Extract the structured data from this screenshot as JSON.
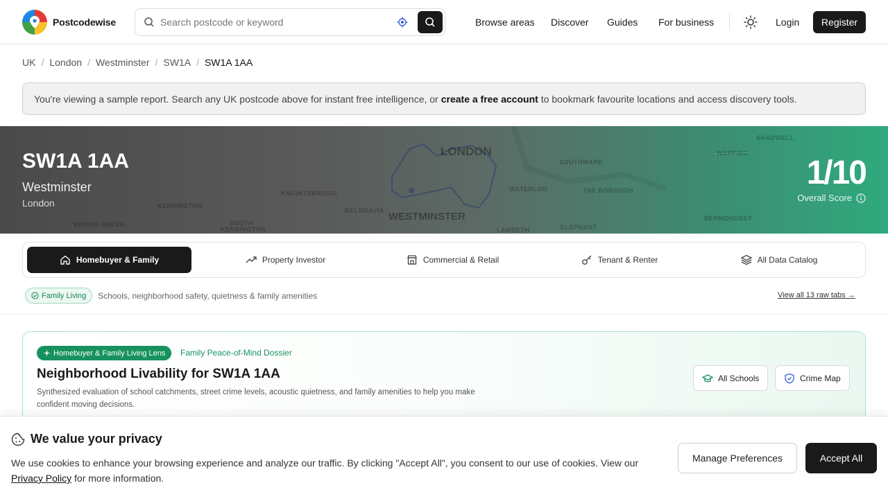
{
  "brand": {
    "name": "Postcodewise"
  },
  "search": {
    "placeholder": "Search postcode or keyword"
  },
  "nav": {
    "browse": "Browse areas",
    "discover": "Discover",
    "guides": "Guides",
    "business": "For business",
    "login": "Login",
    "register": "Register"
  },
  "breadcrumb": [
    "UK",
    "London",
    "Westminster",
    "SW1A",
    "SW1A 1AA"
  ],
  "notice": {
    "before": "You're viewing a sample report. Search any UK postcode above for instant free intelligence, or",
    "link": "create a free account",
    "after": "to bookmark favourite locations and access discovery tools."
  },
  "hero": {
    "postcode": "SW1A 1AA",
    "district": "Westminster",
    "city": "London",
    "score": "1/10",
    "score_label": "Overall Score",
    "map_labels": [
      "LONDON",
      "WESTMINSTER",
      "KENSINGTON",
      "KNIGHTSBRIDGE",
      "BELGRAVIA",
      "SOUTHWARK",
      "WATERLOO",
      "THE BOROUGH",
      "LAMBETH",
      "ELEPHANT",
      "BERMONDSEY",
      "SOUTH KENSINGTON",
      "BROOK GREEN",
      "SHADWELL",
      "WAPPING"
    ]
  },
  "tabs": [
    {
      "label": "Homebuyer & Family",
      "icon": "home-icon"
    },
    {
      "label": "Property Investor",
      "icon": "trending-up-icon"
    },
    {
      "label": "Commercial & Retail",
      "icon": "store-icon"
    },
    {
      "label": "Tenant & Renter",
      "icon": "key-icon"
    },
    {
      "label": "All Data Catalog",
      "icon": "layers-icon"
    }
  ],
  "lens": {
    "chip": "Family Living",
    "desc": "Schools, neighborhood safety, quietness & family amenities",
    "view_all": "View all 13 raw tabs →"
  },
  "card": {
    "badge": "Homebuyer & Family Living Lens",
    "dossier": "Family Peace-of-Mind Dossier",
    "title": "Neighborhood Livability for SW1A 1AA",
    "desc": "Synthesized evaluation of school catchments, street crime levels, acoustic quietness, and family amenities to help you make confident moving decisions.",
    "btn_schools": "All Schools",
    "btn_crime": "Crime Map"
  },
  "cookie": {
    "title": "We value your privacy",
    "text": "We use cookies to enhance your browsing experience and analyze our traffic. By clicking \"Accept All\", you consent to our use of cookies. View our",
    "policy": "Privacy Policy",
    "after": "for more information.",
    "manage": "Manage Preferences",
    "accept": "Accept All"
  }
}
